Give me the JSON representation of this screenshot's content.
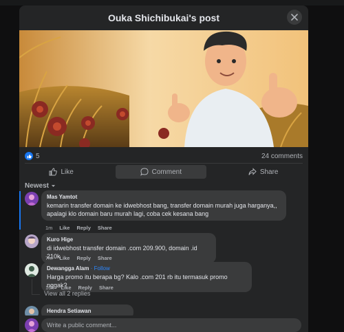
{
  "modal": {
    "title": "Ouka Shichibukai's post"
  },
  "post": {
    "like_count": "5",
    "comment_count": "24 comments"
  },
  "actions": {
    "like": "Like",
    "comment": "Comment",
    "share": "Share"
  },
  "sort": {
    "label": "Newest"
  },
  "comments": [
    {
      "name": "Mas Yamtot",
      "text": [
        "kemarin transfer domain ke idwebhost bang, transfer domain murah juga harganya,,",
        "apalagi klo domain baru murah lagi, coba cek kesana bang"
      ],
      "time": "1m",
      "like": "Like",
      "reply": "Reply",
      "share": "Share"
    },
    {
      "name": "Kuro Hige",
      "text": [
        "di idwebhost transfer domain .com 209.900, domain .id 210k"
      ],
      "time": "7m",
      "like": "Like",
      "reply": "Reply",
      "share": "Share"
    },
    {
      "name": "Dewangga Alam",
      "follow": "· Follow",
      "text": [
        "Harga promo itu berapa bg? Kalo .com 201 rb itu termasuk promo nggak?"
      ],
      "time": "16h",
      "like": "Like",
      "reply": "Reply",
      "share": "Share"
    },
    {
      "name": "Hendra Setiawan",
      "text": []
    }
  ],
  "view_replies": "View all 2 replies",
  "composer": {
    "placeholder": "Write a public comment..."
  },
  "colors": {
    "accent": "#1877f2",
    "follow": "#2d88ff",
    "bubble": "#3a3b3c",
    "surface": "#242526"
  }
}
